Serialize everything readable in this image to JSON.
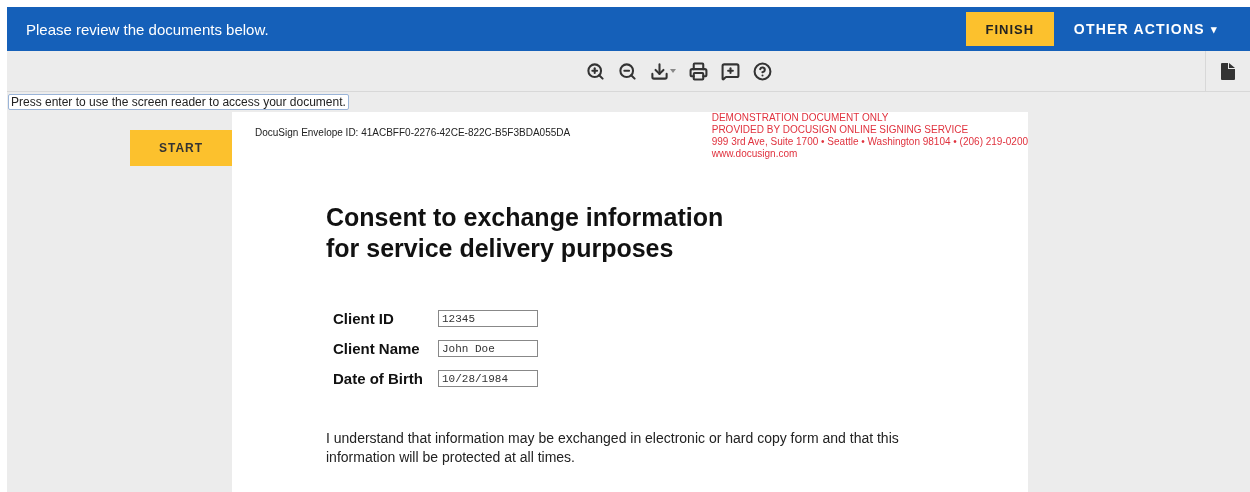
{
  "header": {
    "message": "Please review the documents below.",
    "finish_button": "FINISH",
    "other_actions": "OTHER ACTIONS",
    "other_actions_caret": "▾"
  },
  "toolbar": {
    "tools": [
      {
        "kind": "zoom-in"
      },
      {
        "kind": "zoom-out"
      },
      {
        "kind": "download"
      },
      {
        "kind": "print"
      },
      {
        "kind": "comment"
      },
      {
        "kind": "help"
      }
    ]
  },
  "screen_reader_note": "Press enter to use the screen reader to access your document.",
  "start_button": "START",
  "document": {
    "envelope_id": "DocuSign Envelope ID: 41ACBFF0-2276-42CE-822C-B5F3BDA055DA",
    "demo_notice": [
      "DEMONSTRATION DOCUMENT ONLY",
      "PROVIDED BY DOCUSIGN ONLINE SIGNING SERVICE",
      "999 3rd Ave, Suite 1700  • Seattle • Washington 98104 • (206) 219-0200",
      "www.docusign.com"
    ],
    "title": [
      "Consent to exchange information",
      "for service delivery purposes"
    ],
    "fields": [
      {
        "label": "Client ID",
        "value": "12345"
      },
      {
        "label": "Client Name",
        "value": "John Doe"
      },
      {
        "label": "Date of Birth",
        "value": "10/28/1984"
      }
    ],
    "paragraph": "I understand that information may be exchanged in electronic or hard copy form and that this information will be protected at all times."
  }
}
